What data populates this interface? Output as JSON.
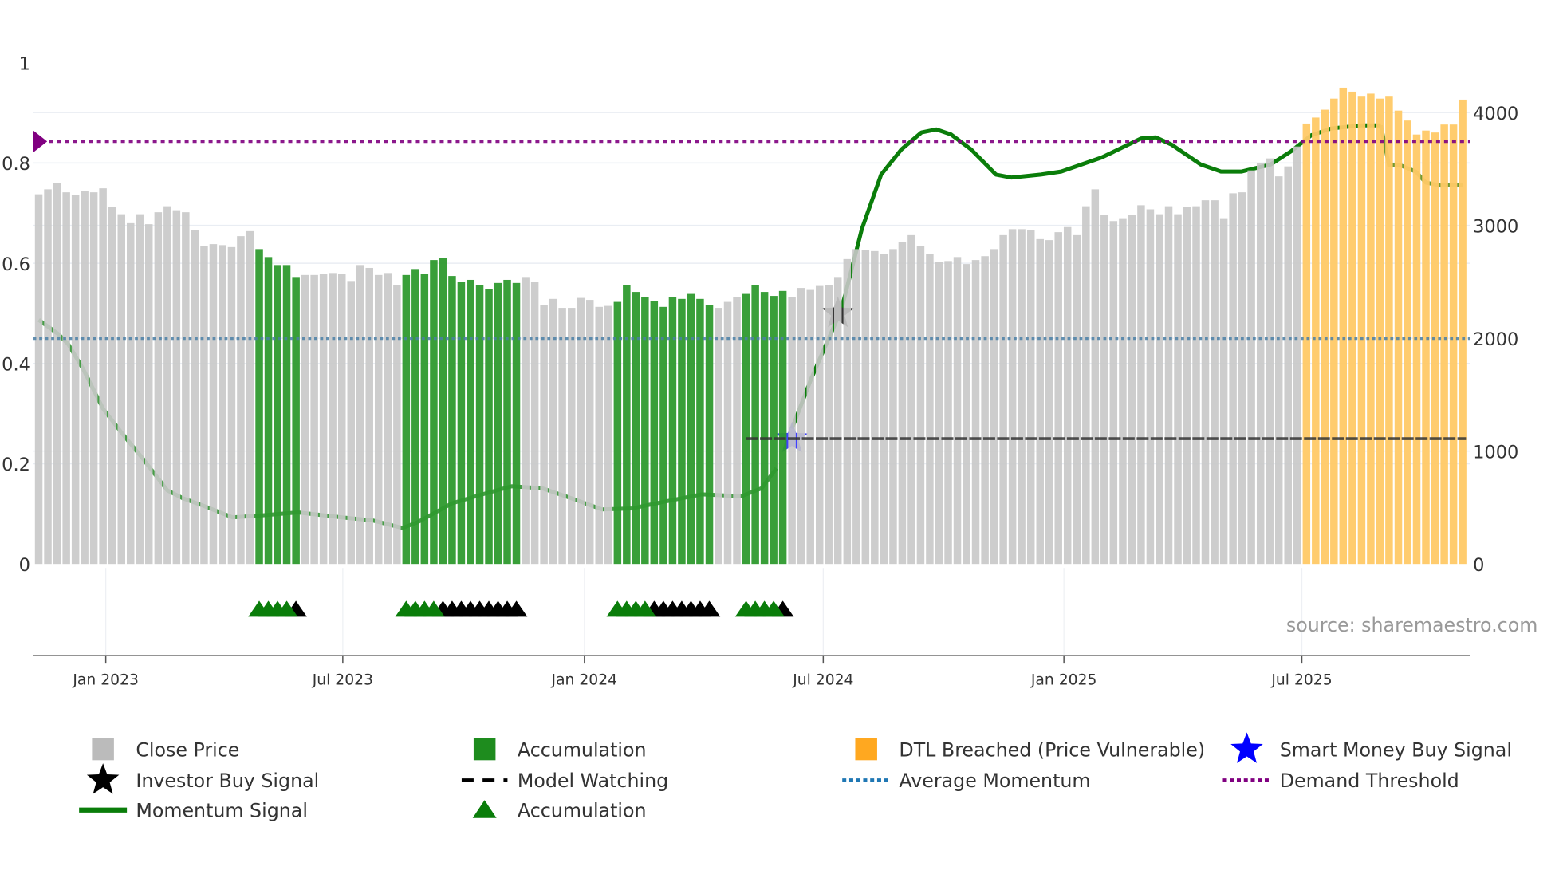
{
  "chart_data": {
    "type": "bar",
    "title": "",
    "source_note": "source: sharemaestro.com",
    "x_unit": "weekly bars (index 0 = first week shown)",
    "x_ticks": [
      {
        "label": "Jan 2023",
        "week": 7.3
      },
      {
        "label": "Jul 2023",
        "week": 33.1
      },
      {
        "label": "Jan 2024",
        "week": 59.4
      },
      {
        "label": "Jul 2024",
        "week": 85.4
      },
      {
        "label": "Jan 2025",
        "week": 111.6
      },
      {
        "label": "Jul 2025",
        "week": 137.5
      }
    ],
    "left_axis": {
      "ylim": [
        0,
        1
      ],
      "ticks": [
        "0",
        "0.2",
        "0.4",
        "0.6",
        "0.8",
        "1"
      ],
      "tick_values": [
        0,
        0.2,
        0.4,
        0.6,
        0.8,
        1
      ]
    },
    "right_axis": {
      "ylim": [
        0,
        4440
      ],
      "ticks": [
        "0",
        "1000",
        "2000",
        "3000",
        "4000"
      ],
      "tick_values": [
        0,
        1000,
        2000,
        3000,
        4000
      ]
    },
    "close_price": [
      3276,
      3320,
      3373,
      3294,
      3267,
      3302,
      3294,
      3329,
      3161,
      3099,
      3020,
      3099,
      3011,
      3117,
      3170,
      3135,
      3117,
      2958,
      2817,
      2834,
      2826,
      2808,
      2905,
      2949,
      2790,
      2720,
      2649,
      2649,
      2543,
      2561,
      2561,
      2570,
      2578,
      2570,
      2508,
      2649,
      2623,
      2561,
      2578,
      2472,
      2561,
      2614,
      2570,
      2693,
      2711,
      2552,
      2499,
      2517,
      2472,
      2437,
      2490,
      2517,
      2490,
      2543,
      2499,
      2296,
      2349,
      2269,
      2269,
      2358,
      2340,
      2278,
      2287,
      2322,
      2472,
      2411,
      2366,
      2331,
      2278,
      2366,
      2349,
      2393,
      2349,
      2296,
      2269,
      2322,
      2366,
      2393,
      2472,
      2411,
      2375,
      2419,
      2366,
      2446,
      2428,
      2464,
      2472,
      2543,
      2702,
      2790,
      2781,
      2773,
      2746,
      2790,
      2852,
      2914,
      2817,
      2746,
      2676,
      2684,
      2720,
      2658,
      2693,
      2728,
      2790,
      2914,
      2967,
      2967,
      2958,
      2879,
      2870,
      2940,
      2985,
      2914,
      3170,
      3320,
      3091,
      3038,
      3064,
      3091,
      3179,
      3143,
      3099,
      3170,
      3099,
      3161,
      3170,
      3223,
      3223,
      3064,
      3285,
      3294,
      3488,
      3550,
      3594,
      3435,
      3523,
      3700,
      3903,
      3956,
      4026,
      4124,
      4221,
      4185,
      4141,
      4168,
      4124,
      4141,
      4018,
      3929,
      3806,
      3841,
      3823,
      3894,
      3894,
      4115
    ],
    "bar_state_ranges": [
      {
        "state": "accumulation",
        "from": 24,
        "to": 28
      },
      {
        "state": "accumulation",
        "from": 40,
        "to": 52
      },
      {
        "state": "accumulation",
        "from": 63,
        "to": 73
      },
      {
        "state": "accumulation",
        "from": 77,
        "to": 81
      },
      {
        "state": "dtl_breached",
        "from": 138,
        "to": 155
      }
    ],
    "momentum_signal": [
      [
        0,
        0.487
      ],
      [
        2.1,
        0.459
      ],
      [
        3.2,
        0.439
      ],
      [
        4.8,
        0.39
      ],
      [
        7,
        0.31
      ],
      [
        9.1,
        0.26
      ],
      [
        11.3,
        0.211
      ],
      [
        14,
        0.147
      ],
      [
        15.7,
        0.131
      ],
      [
        17.8,
        0.117
      ],
      [
        21.1,
        0.093
      ],
      [
        24.3,
        0.097
      ],
      [
        28.2,
        0.103
      ],
      [
        33,
        0.093
      ],
      [
        36.3,
        0.087
      ],
      [
        39.6,
        0.072
      ],
      [
        41.2,
        0.083
      ],
      [
        45,
        0.121
      ],
      [
        48.3,
        0.139
      ],
      [
        51.5,
        0.155
      ],
      [
        54.8,
        0.151
      ],
      [
        58,
        0.131
      ],
      [
        61.3,
        0.109
      ],
      [
        64.6,
        0.111
      ],
      [
        67.8,
        0.123
      ],
      [
        72.2,
        0.139
      ],
      [
        76.5,
        0.135
      ],
      [
        78.7,
        0.151
      ],
      [
        80.3,
        0.191
      ],
      [
        82,
        0.27
      ],
      [
        84.1,
        0.37
      ],
      [
        87.4,
        0.509
      ],
      [
        89.6,
        0.668
      ],
      [
        91.7,
        0.777
      ],
      [
        93.9,
        0.827
      ],
      [
        96.1,
        0.861
      ],
      [
        97.7,
        0.867
      ],
      [
        99.3,
        0.857
      ],
      [
        101.5,
        0.827
      ],
      [
        104.2,
        0.777
      ],
      [
        105.9,
        0.771
      ],
      [
        109.1,
        0.777
      ],
      [
        111.3,
        0.783
      ],
      [
        115.7,
        0.811
      ],
      [
        120,
        0.849
      ],
      [
        121.6,
        0.851
      ],
      [
        123.3,
        0.837
      ],
      [
        126.5,
        0.797
      ],
      [
        128.7,
        0.783
      ],
      [
        130.9,
        0.783
      ],
      [
        134.1,
        0.797
      ],
      [
        136.3,
        0.823
      ],
      [
        138.5,
        0.855
      ],
      [
        140.7,
        0.869
      ],
      [
        143.9,
        0.875
      ],
      [
        146.1,
        0.875
      ],
      [
        147,
        0.795
      ],
      [
        148.3,
        0.795
      ],
      [
        149.9,
        0.783
      ],
      [
        151,
        0.761
      ],
      [
        152.6,
        0.755
      ],
      [
        153.7,
        0.757
      ],
      [
        155,
        0.755
      ]
    ],
    "average_momentum": 0.45,
    "demand_threshold": 0.843,
    "model_watching": {
      "value": 0.25,
      "from": 77,
      "to": 155
    },
    "investor_buy_signal": {
      "week": 87,
      "value": 0.5
    },
    "smart_money_buy_signal": {
      "week": 82,
      "value": 0.25
    },
    "accumulation_markers": {
      "green": [
        24,
        25,
        26,
        27,
        40,
        41,
        42,
        43,
        63,
        64,
        65,
        66,
        77,
        78,
        79,
        80
      ],
      "black": [
        28,
        44,
        45,
        46,
        47,
        48,
        49,
        50,
        51,
        52,
        67,
        68,
        69,
        70,
        71,
        72,
        73,
        81
      ]
    },
    "colors": {
      "close_price": "#c8c8c8",
      "accumulation": "#2e9a2e",
      "dtl_breached": "#ffc966",
      "momentum": "#0a7d0a",
      "average_momentum": "#4a7fa6",
      "demand_threshold": "#800080",
      "model_watching": "#333333",
      "smart_money": "#0000ff"
    },
    "legend": {
      "placement": "bottom",
      "items": [
        {
          "label": "Close Price",
          "symbol": "square",
          "color": "#bbbbbb"
        },
        {
          "label": "Accumulation",
          "symbol": "square",
          "color": "#1e8c1e"
        },
        {
          "label": "DTL Breached (Price Vulnerable)",
          "symbol": "square",
          "color": "#ffa820"
        },
        {
          "label": "Smart Money Buy Signal",
          "symbol": "star",
          "color": "#0000ff"
        },
        {
          "label": "Investor Buy Signal",
          "symbol": "star",
          "color": "#000000"
        },
        {
          "label": "Model Watching",
          "symbol": "dash",
          "color": "#000000"
        },
        {
          "label": "Average Momentum",
          "symbol": "dot",
          "color": "#1f77b4"
        },
        {
          "label": "Demand Threshold",
          "symbol": "dot",
          "color": "#800080"
        },
        {
          "label": "Momentum Signal",
          "symbol": "line",
          "color": "#0a7d0a"
        },
        {
          "label": "Accumulation",
          "symbol": "triangle",
          "color": "#0a7d0a"
        }
      ]
    }
  }
}
